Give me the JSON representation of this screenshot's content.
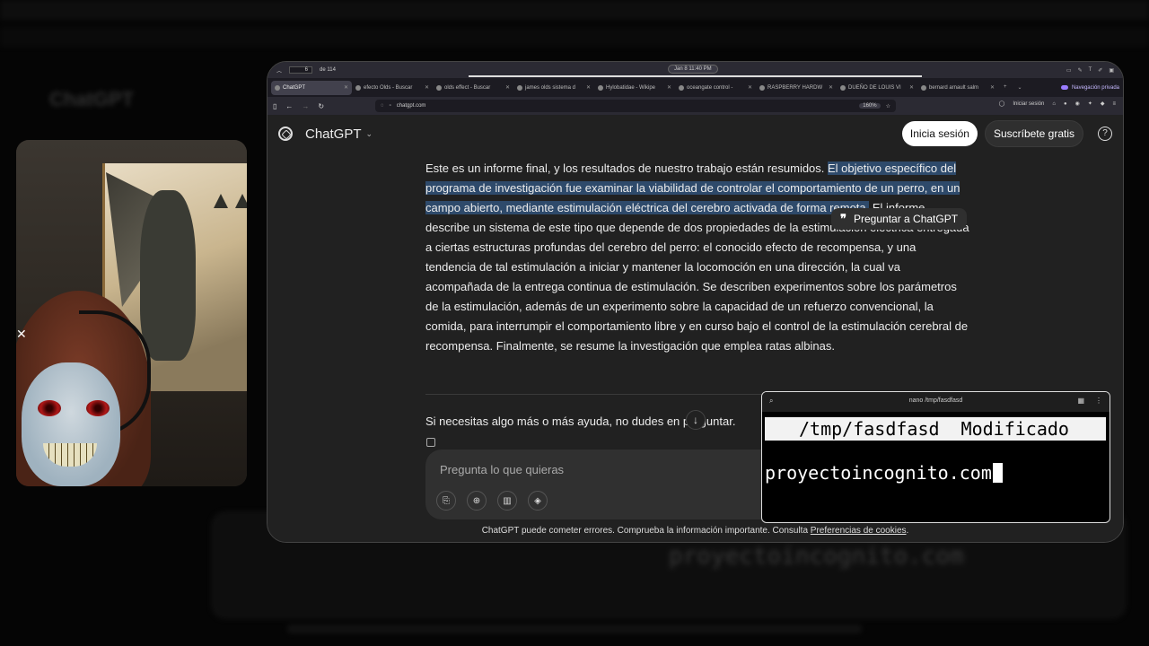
{
  "pdf_toolbar": {
    "page": "6",
    "page_total": "de 114",
    "datetime": "Jan 8  11:40 PM"
  },
  "tabs": [
    {
      "label": "ChatGPT",
      "active": true
    },
    {
      "label": "efecto Olds - Buscar"
    },
    {
      "label": "olds effect - Buscar"
    },
    {
      "label": "james olds sistema d"
    },
    {
      "label": "Hylobatidae - Wikipe"
    },
    {
      "label": "oceangate control - "
    },
    {
      "label": "RASPBERRY HARDW"
    },
    {
      "label": "DUEÑO DE LOUIS VI"
    },
    {
      "label": "bernard arnault salm"
    }
  ],
  "private_label": "Navegación privada",
  "url": "chatgpt.com",
  "zoom": "160%",
  "browser_signin": "Iniciar sesión",
  "app": {
    "brand": "ChatGPT",
    "login": "Inicia sesión",
    "signup": "Suscríbete gratis",
    "help": "?",
    "message_pre": "Este es un informe final, y los resultados de nuestro trabajo están resumidos. ",
    "message_highlight": "El objetivo específico del programa de investigación fue examinar la viabilidad de controlar el comportamiento de un perro, en un campo abierto, mediante estimulación eléctrica del cerebro activada de forma remota.",
    "message_post": " El informe describe un sistema de este tipo que depende de dos propiedades de la estimulación eléctrica entregada a ciertas estructuras profundas del cerebro del perro: el conocido efecto de recompensa, y una tendencia de tal estimulación a iniciar y mantener la locomoción en una dirección, la cual va acompañada de la entrega continua de estimulación. Se describen experimentos sobre los parámetros de la estimulación, además de un experimento sobre la capacidad de un refuerzo convencional, la comida, para interrumpir el comportamiento libre y en curso bajo el control de la estimulación cerebral de recompensa. Finalmente, se resume la investigación que emplea ratas albinas.",
    "ask_popup": "Preguntar a ChatGPT",
    "followup": "Si necesitas algo más o más ayuda, no dudes en preguntar.",
    "composer_placeholder": "Pregunta lo que quieras",
    "footer_text": "ChatGPT puede cometer errores. Comprueba la información importante. Consulta ",
    "footer_link": "Preferencias de cookies",
    "footer_end": "."
  },
  "nano": {
    "window_title": "nano /tmp/fasdfasd",
    "file_path": "/tmp/fasdfasd",
    "status": "Modificado",
    "content": "proyectoincognito.com"
  },
  "background": {
    "title": "ChatGPT",
    "text": "proyectoincognito.com"
  },
  "colors": {
    "highlight": "#2e4a6b",
    "private_accent": "#9a7cff"
  }
}
